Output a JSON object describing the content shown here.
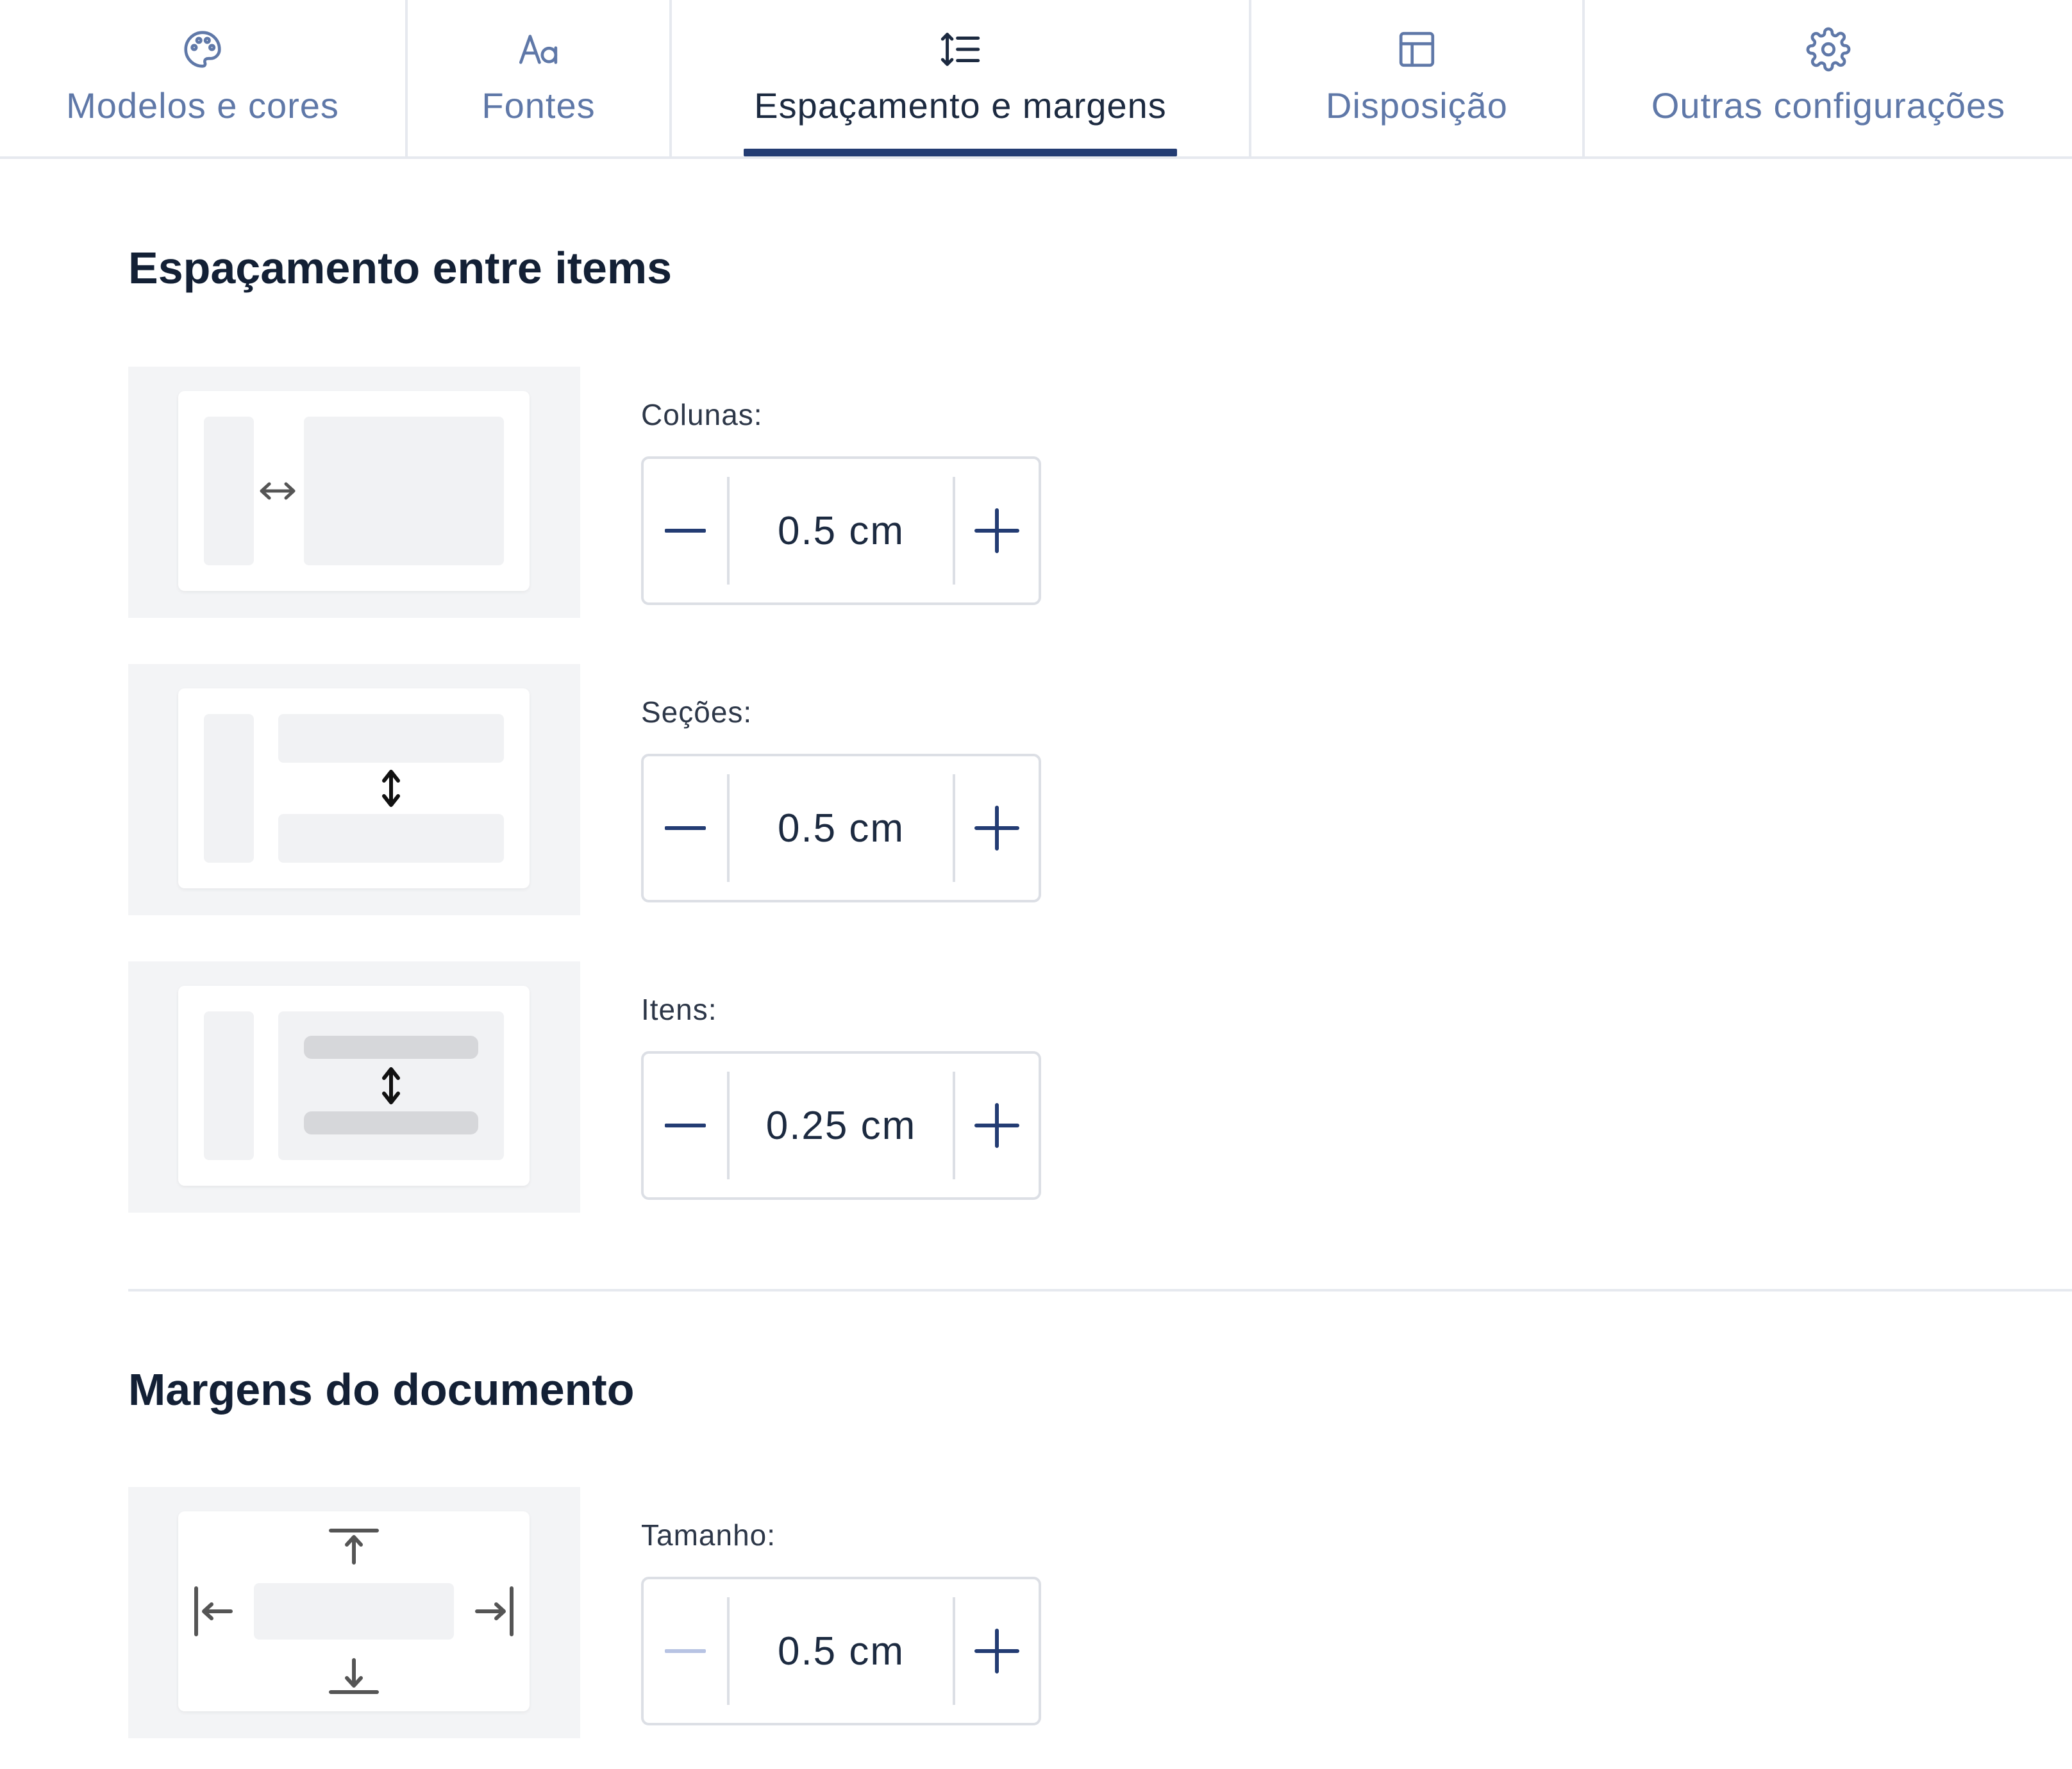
{
  "tabs": [
    {
      "label": "Modelos e cores",
      "icon": "palette-icon"
    },
    {
      "label": "Fontes",
      "icon": "font-aa-icon"
    },
    {
      "label": "Espaçamento e margens",
      "icon": "line-spacing-icon",
      "active": true
    },
    {
      "label": "Disposição",
      "icon": "layout-icon"
    },
    {
      "label": "Outras configurações",
      "icon": "gear-icon"
    }
  ],
  "spacing": {
    "title": "Espaçamento entre items",
    "columns": {
      "label": "Colunas:",
      "value": "0.5 cm"
    },
    "sections": {
      "label": "Seções:",
      "value": "0.5 cm"
    },
    "items": {
      "label": "Itens:",
      "value": "0.25 cm"
    }
  },
  "margins": {
    "title": "Margens do documento",
    "size": {
      "label": "Tamanho:",
      "value": "0.5 cm",
      "minus_disabled": true
    }
  },
  "colors": {
    "accent": "#233c73",
    "tab_inactive": "#5f78a8",
    "text_dark": "#132035",
    "disabled": "#b7c3e3"
  }
}
